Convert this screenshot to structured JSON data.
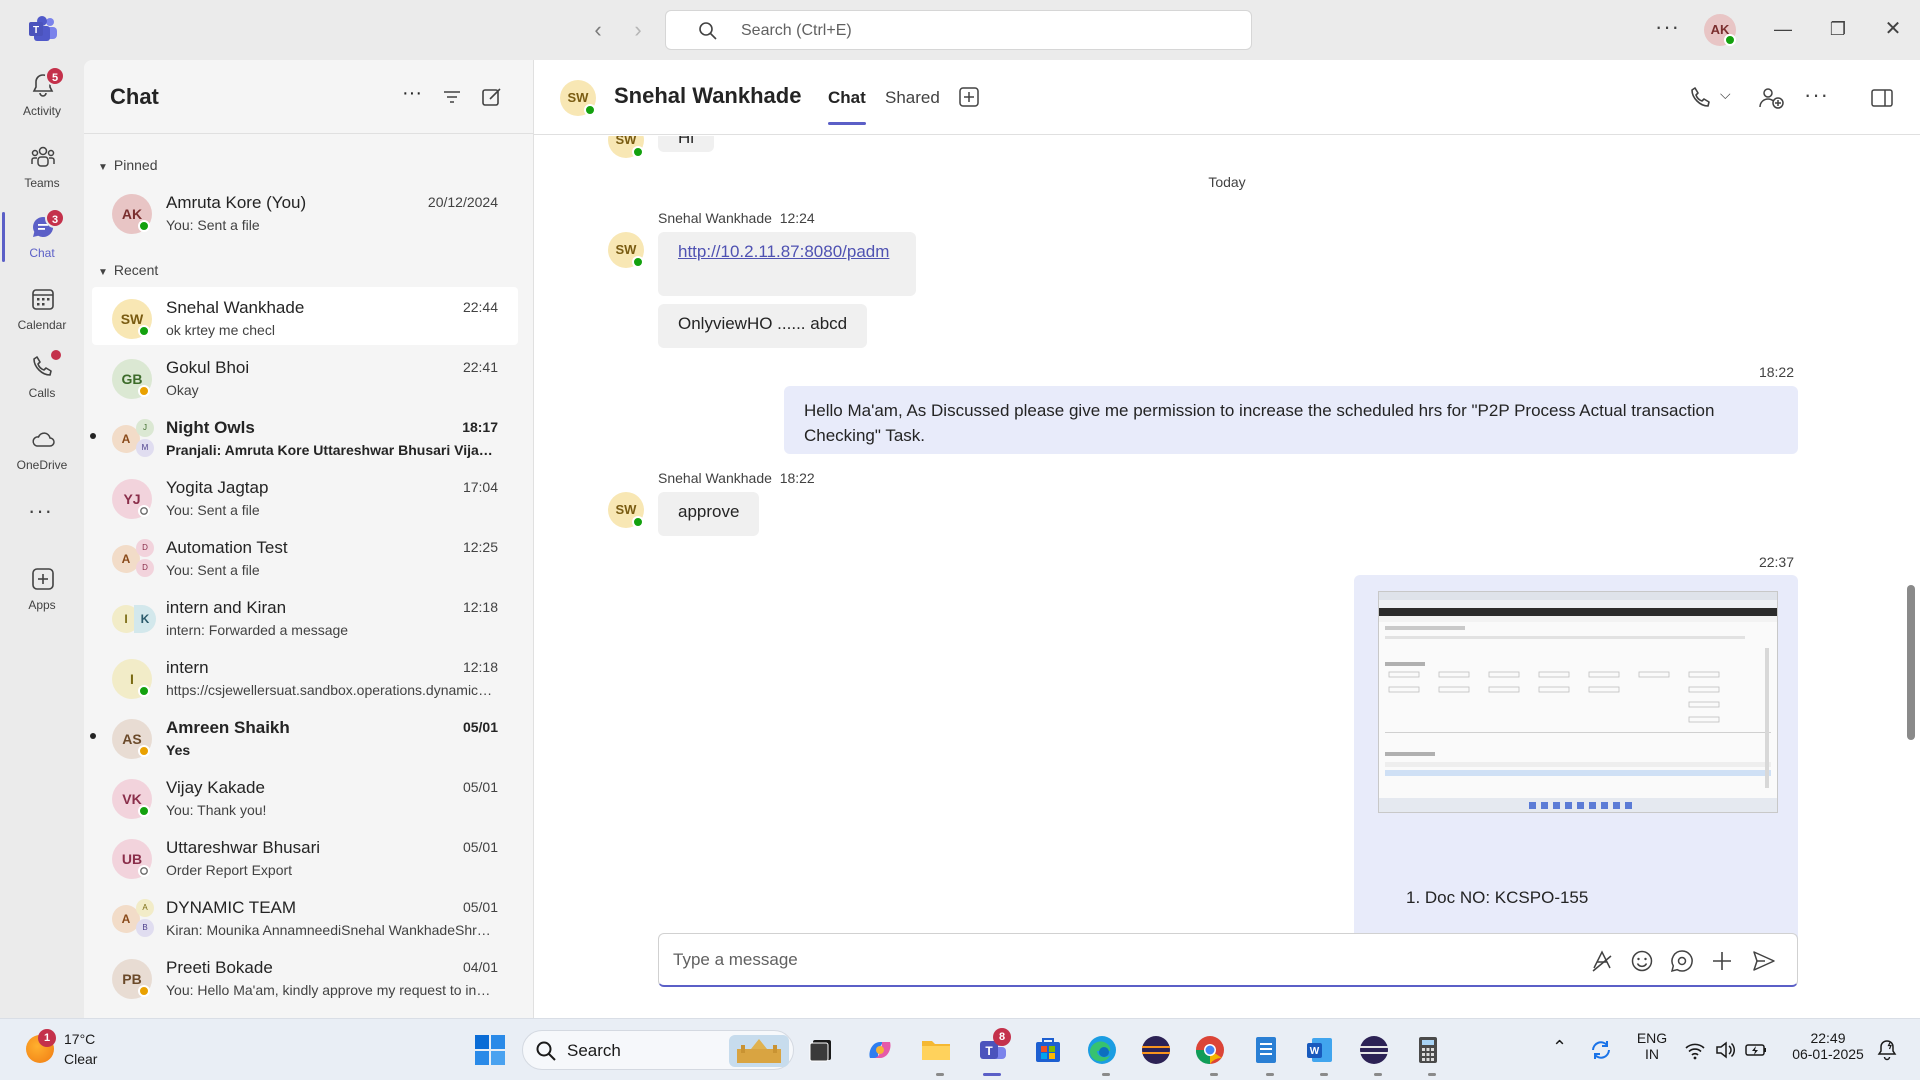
{
  "titlebar": {
    "search_placeholder": "Search (Ctrl+E)",
    "user_initials": "AK"
  },
  "rail": {
    "items": [
      {
        "label": "Activity",
        "badge": "5"
      },
      {
        "label": "Teams",
        "badge": ""
      },
      {
        "label": "Chat",
        "badge": "3"
      },
      {
        "label": "Calendar",
        "badge": ""
      },
      {
        "label": "Calls",
        "badge": ""
      },
      {
        "label": "OneDrive",
        "badge": ""
      },
      {
        "label": "Apps",
        "badge": ""
      }
    ]
  },
  "chatlist": {
    "title": "Chat",
    "pinned_label": "Pinned",
    "recent_label": "Recent",
    "pinned": [
      {
        "initials": "AK",
        "name": "Amruta Kore (You)",
        "preview": "You: Sent a file",
        "time": "20/12/2024"
      }
    ],
    "recent": [
      {
        "initials": "SW",
        "name": "Snehal Wankhade",
        "preview": "ok krtey me checl",
        "time": "22:44"
      },
      {
        "initials": "GB",
        "name": "Gokul Bhoi",
        "preview": "Okay",
        "time": "22:41"
      },
      {
        "initials": "A",
        "name": "Night Owls",
        "preview": "Pranjali: Amruta Kore Uttareshwar Bhusari Vijay Kakade",
        "time": "18:17",
        "g2": "J",
        "g3": "M"
      },
      {
        "initials": "YJ",
        "name": "Yogita Jagtap",
        "preview": "You: Sent a file",
        "time": "17:04"
      },
      {
        "initials": "A",
        "name": "Automation Test",
        "preview": "You: Sent a file",
        "time": "12:25",
        "g2": "D",
        "g3": "D"
      },
      {
        "initials": "I",
        "name": "intern and Kiran",
        "preview": "intern: Forwarded a message",
        "time": "12:18",
        "g2": "K",
        "g3": ""
      },
      {
        "initials": "I",
        "name": "intern",
        "preview": "https://csjewellersuat.sandbox.operations.dynamics.com",
        "time": "12:18"
      },
      {
        "initials": "AS",
        "name": "Amreen Shaikh",
        "preview": "Yes",
        "time": "05/01"
      },
      {
        "initials": "VK",
        "name": "Vijay Kakade",
        "preview": "You: Thank you!",
        "time": "05/01"
      },
      {
        "initials": "UB",
        "name": "Uttareshwar Bhusari",
        "preview": "Order Report Export",
        "time": "05/01"
      },
      {
        "initials": "A",
        "name": "DYNAMIC TEAM",
        "preview": "Kiran: Mounika AnnamneediSnehal WankhadeShreya",
        "time": "05/01",
        "g2": "A",
        "g3": "B"
      },
      {
        "initials": "PB",
        "name": "Preeti Bokade",
        "preview": "You: Hello Ma'am, kindly approve my request to increase",
        "time": "04/01"
      }
    ]
  },
  "conversation": {
    "initials": "SW",
    "name": "Snehal Wankhade",
    "tabs": [
      "Chat",
      "Shared"
    ],
    "partial_top_text": "Hi",
    "day_separator": "Today",
    "msg1_sender": "Snehal Wankhade",
    "msg1_time": "12:24",
    "msg1_link": "http://10.2.11.87:8080/padm",
    "msg1b_text": "OnlyviewHO ...... abcd",
    "msg2_time": "18:22",
    "msg2_text": "Hello Ma'am, As Discussed please give me permission to increase the scheduled hrs for \"P2P Process Actual transaction Checking\" Task.",
    "msg3_sender": "Snehal Wankhade",
    "msg3_time": "18:22",
    "msg3_text": "approve",
    "msg4_time": "22:37",
    "msg4_caption": "1. Doc NO: KCSPO-155",
    "compose_placeholder": "Type a message"
  },
  "taskbar": {
    "weather_badge": "1",
    "temperature": "17°C",
    "condition": "Clear",
    "search_label": "Search",
    "teams_badge": "8",
    "lang_line1": "ENG",
    "lang_line2": "IN",
    "time": "22:49",
    "date": "06-01-2025"
  },
  "colors": {
    "accent": "#5b5fc7",
    "badge": "#c4314b",
    "presence_available": "#13a10e",
    "presence_away": "#e9a100"
  }
}
